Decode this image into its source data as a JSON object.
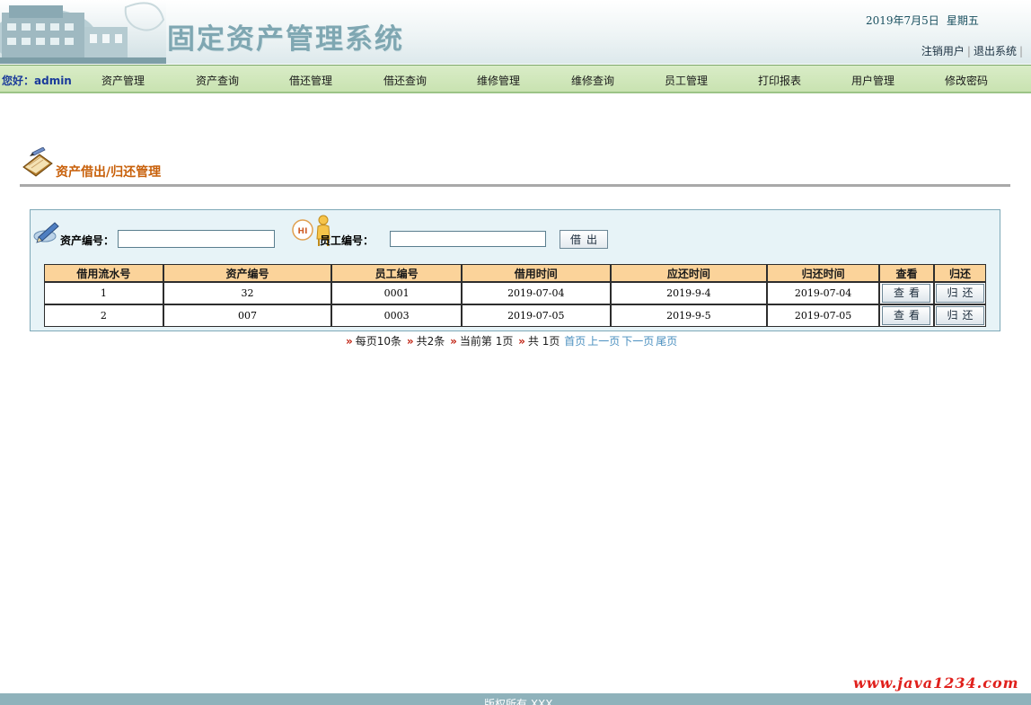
{
  "header": {
    "title": "固定资产管理系统",
    "date": "2019年7月5日",
    "weekday": "星期五",
    "logout_user": "注销用户",
    "separator": "|",
    "exit_system": "退出系统"
  },
  "nav": {
    "greeting": "您好：admin",
    "items": [
      {
        "label": "资产管理"
      },
      {
        "label": "资产查询"
      },
      {
        "label": "借还管理"
      },
      {
        "label": "借还查询"
      },
      {
        "label": "维修管理"
      },
      {
        "label": "维修查询"
      },
      {
        "label": "员工管理"
      },
      {
        "label": "打印报表"
      },
      {
        "label": "用户管理"
      },
      {
        "label": "修改密码"
      }
    ]
  },
  "section": {
    "title": "资产借出/归还管理",
    "icon": "book-pencil-icon"
  },
  "form": {
    "asset_label": "资产编号：",
    "asset_value": "",
    "hi_badge": "HI",
    "staff_label": "员工编号：",
    "staff_value": "",
    "lend_button": "借出"
  },
  "table": {
    "headers": [
      "借用流水号",
      "资产编号",
      "员工编号",
      "借用时间",
      "应还时间",
      "归还时间",
      "查看",
      "归还"
    ],
    "view_label": "查看",
    "return_label": "归还",
    "rows": [
      {
        "serial": "1",
        "asset": "32",
        "staff": "0001",
        "borrow": "2019-07-04",
        "due": "2019-9-4",
        "returned": "2019-07-04"
      },
      {
        "serial": "2",
        "asset": "007",
        "staff": "0003",
        "borrow": "2019-07-05",
        "due": "2019-9-5",
        "returned": "2019-07-05"
      }
    ]
  },
  "pager": {
    "per_page": "每页10条",
    "total": "共2条",
    "current": "当前第 1页",
    "pages": "共 1页",
    "first": "首页",
    "prev": "上一页",
    "next": "下一页",
    "last": "尾页"
  },
  "watermark": "www.java1234.com",
  "footer": "版权所有 XXX",
  "colors": {
    "nav_bg": "#c9e3b1",
    "panel_bg": "#e7f3f7",
    "table_header_bg": "#fbd39a",
    "section_title": "#c8600a",
    "watermark": "#e0201c",
    "footer_bg": "#8fb2bb"
  }
}
